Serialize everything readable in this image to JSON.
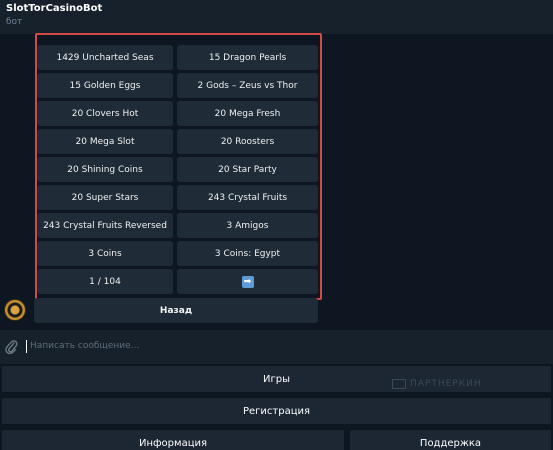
{
  "header": {
    "title": "SlotTorCasinoBot",
    "subtitle": "бот"
  },
  "inline_keyboard": {
    "rows": [
      [
        "1429 Uncharted Seas",
        "15 Dragon Pearls"
      ],
      [
        "15 Golden Eggs",
        "2 Gods – Zeus vs Thor"
      ],
      [
        "20 Clovers Hot",
        "20 Mega Fresh"
      ],
      [
        "20 Mega Slot",
        "20 Roosters"
      ],
      [
        "20 Shining Coins",
        "20 Star Party"
      ],
      [
        "20 Super Stars",
        "243 Crystal Fruits"
      ],
      [
        "243 Crystal Fruits Reversed",
        "3 Amigos"
      ],
      [
        "3 Coins",
        "3 Coins: Egypt"
      ]
    ],
    "page_indicator": "1 / 104",
    "next_icon": "right-arrow-icon",
    "next_glyph": "➡",
    "back_label": "Назад"
  },
  "composer": {
    "placeholder": "Написать сообщение..."
  },
  "reply_keyboard": {
    "games": "Игры",
    "registration": "Регистрация",
    "info": "Информация",
    "support": "Поддержка"
  },
  "watermark": "ПАРТНЕРКИН",
  "colors": {
    "highlight": "#d24a43",
    "background": "#0e1621",
    "button": "#1f2b36"
  }
}
